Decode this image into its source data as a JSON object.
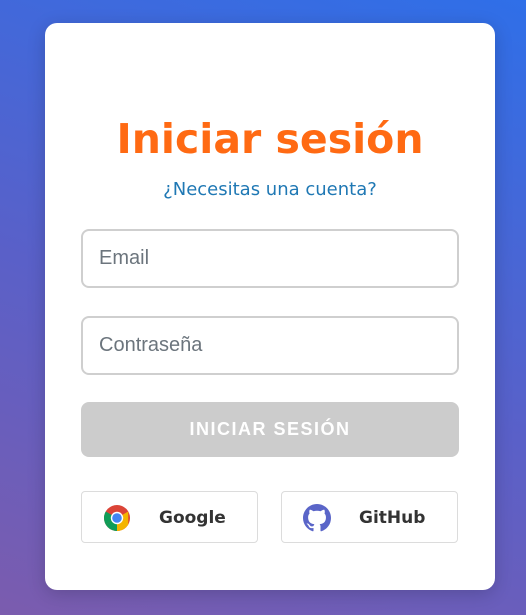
{
  "login": {
    "title": "Iniciar sesión",
    "signup_link": "¿Necesitas una cuenta?",
    "email_placeholder": "Email",
    "email_value": "",
    "password_placeholder": "Contraseña",
    "password_value": "",
    "submit_label": "INICIAR SESIÓN"
  },
  "social": {
    "google": {
      "label": "Google",
      "icon": "google-chrome-icon"
    },
    "github": {
      "label": "GitHub",
      "icon": "github-icon"
    }
  },
  "colors": {
    "title": "#ff6a13",
    "link": "#1f78b4",
    "submit_disabled": "#cccccc",
    "github_icon": "#5a65c8"
  }
}
